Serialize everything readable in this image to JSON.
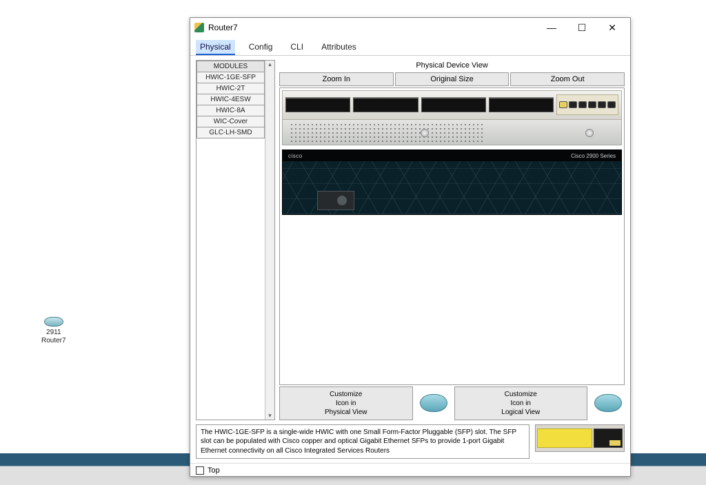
{
  "desktop": {
    "device_model": "2911",
    "device_name": "Router7"
  },
  "window": {
    "title": "Router7",
    "tabs": [
      "Physical",
      "Config",
      "CLI",
      "Attributes"
    ],
    "active_tab_index": 0
  },
  "modules": {
    "header": "MODULES",
    "items": [
      "HWIC-1GE-SFP",
      "HWIC-2T",
      "HWIC-4ESW",
      "HWIC-8A",
      "WIC-Cover",
      "GLC-LH-SMD"
    ]
  },
  "physical_view": {
    "title": "Physical Device View",
    "zoom_buttons": {
      "in": "Zoom In",
      "orig": "Original Size",
      "out": "Zoom Out"
    },
    "front_brand": "cisco",
    "front_series": "Cisco 2900 Series",
    "customize_physical": {
      "l1": "Customize",
      "l2": "Icon in",
      "l3": "Physical View"
    },
    "customize_logical": {
      "l1": "Customize",
      "l2": "Icon in",
      "l3": "Logical View"
    }
  },
  "description": "The HWIC-1GE-SFP is a single-wide HWIC with one Small Form-Factor Pluggable (SFP) slot. The SFP slot can be populated with Cisco copper and optical Gigabit Ethernet SFPs to provide 1-port Gigabit Ethernet connectivity on all Cisco Integrated Services Routers",
  "footer": {
    "top_checkbox_label": "Top",
    "top_checked": false
  }
}
